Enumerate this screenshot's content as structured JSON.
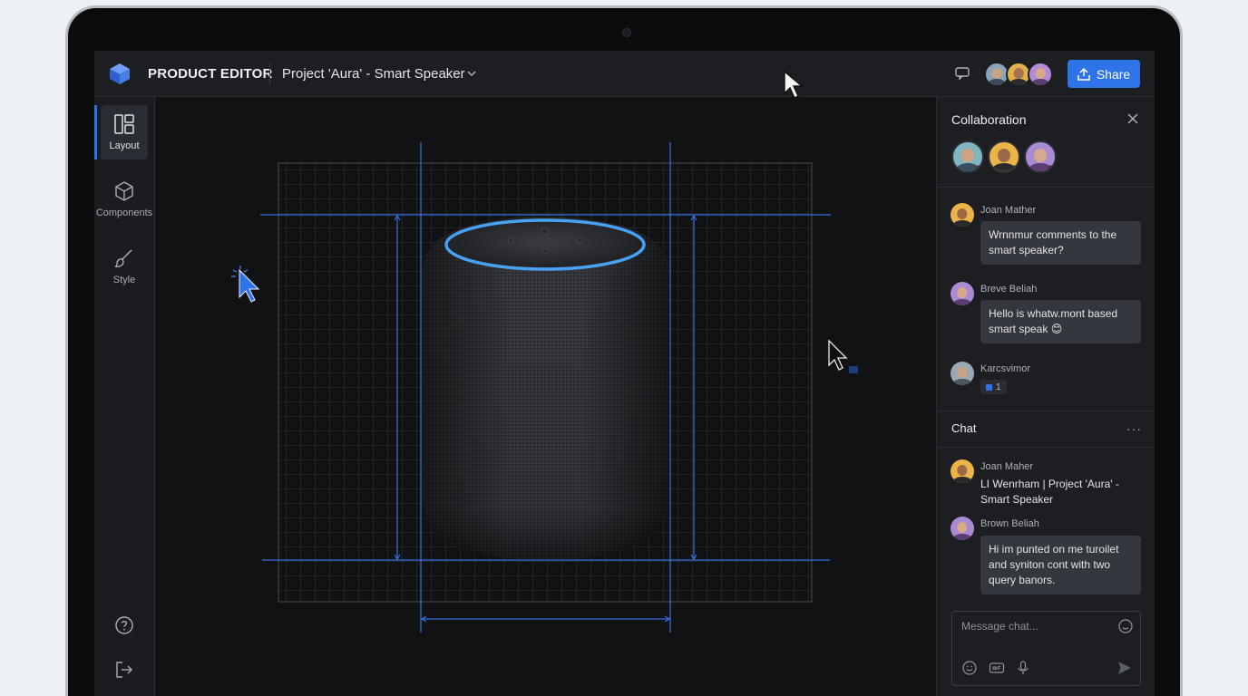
{
  "app": {
    "title": "PRODUCT EDITOR",
    "project": "Project 'Aura' - Smart Speaker",
    "share_label": "Share"
  },
  "rail": {
    "items": [
      {
        "label": "Layout",
        "icon": "layout-icon",
        "active": true
      },
      {
        "label": "Components",
        "icon": "cube-icon",
        "active": false
      },
      {
        "label": "Style",
        "icon": "brush-icon",
        "active": false
      }
    ],
    "bottom_icons": [
      "help-icon",
      "logout-icon"
    ]
  },
  "collaboration": {
    "title": "Collaboration",
    "comments": [
      {
        "name": "Joan Mather",
        "text": "Wrnnmur comments to the smart speaker?"
      },
      {
        "name": "Breve Beliah",
        "text": "Hello is whatw.mont based smart speak 😊"
      },
      {
        "name": "Karcsvimor",
        "reaction_count": "1"
      }
    ]
  },
  "chat": {
    "title": "Chat",
    "more": "···",
    "messages": [
      {
        "name": "Joan Maher",
        "text": "LI Wenrham | Project 'Aura' - Smart Speaker"
      },
      {
        "name": "Brown Beliah",
        "text": "Hi im punted on me turoilet and syniton cont with two query banors."
      }
    ],
    "input_placeholder": "Message chat..."
  },
  "colors": {
    "accent": "#2f73e8",
    "guide_line": "#3b6fe0",
    "speaker_ring": "#4aa8ff"
  }
}
